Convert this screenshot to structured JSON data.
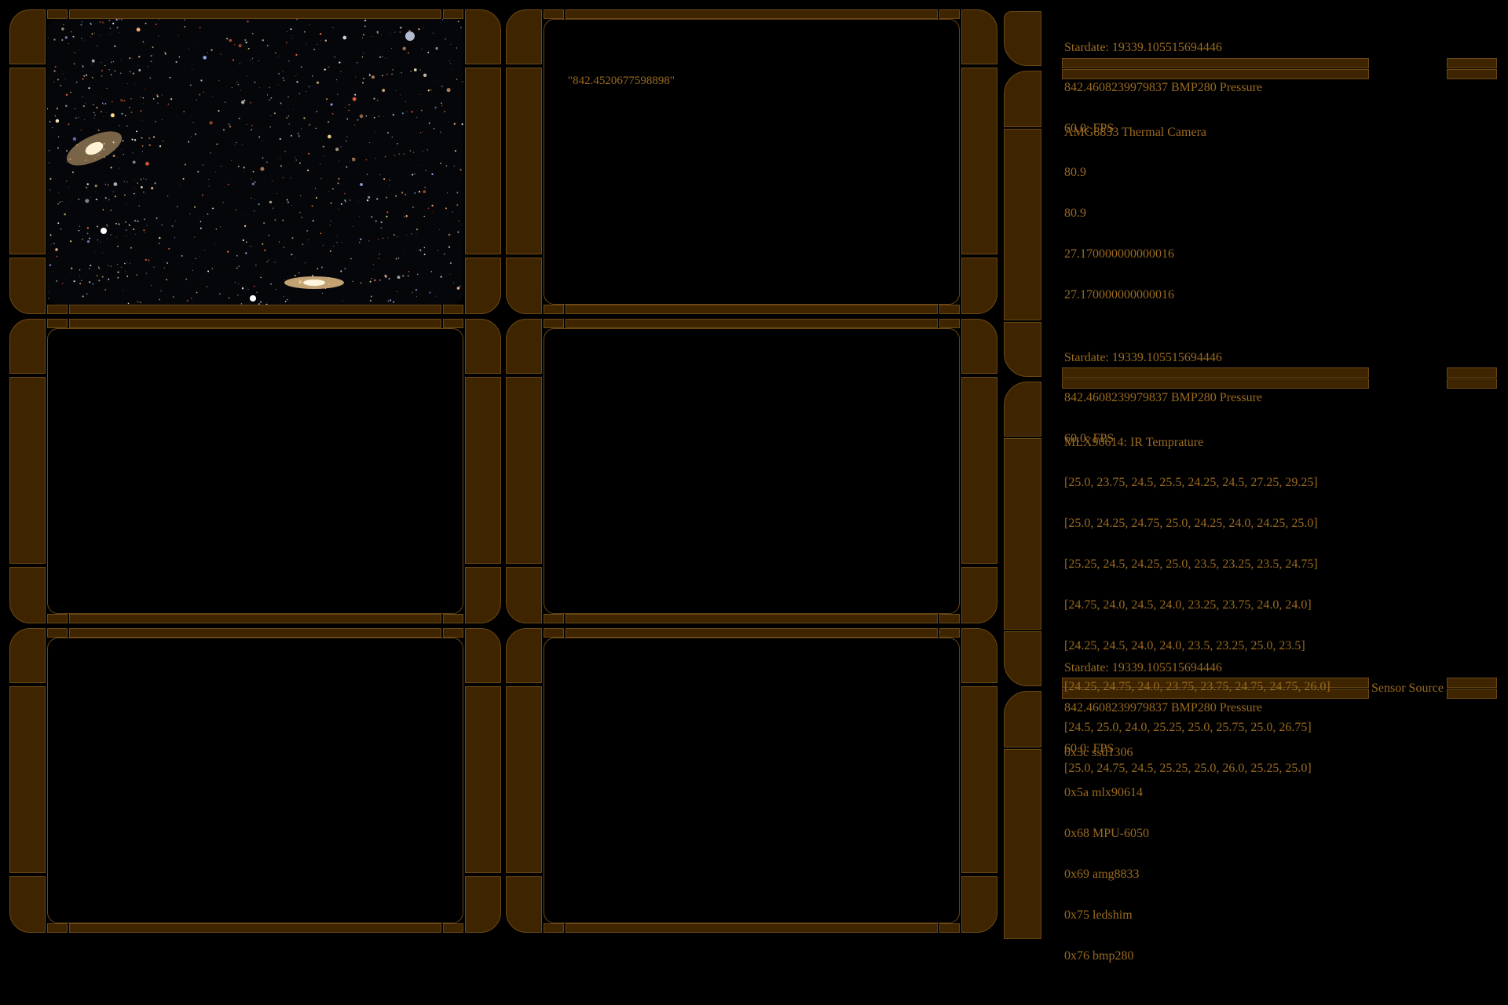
{
  "center_panel": {
    "readout": "\"842.4520677598898\""
  },
  "status_blocks": [
    {
      "stardate": "Stardate: 19339.105515694446",
      "pressure": "842.4608239979837 BMP280 Pressure",
      "fps": "60.0: FPS"
    },
    {
      "stardate": "Stardate: 19339.105515694446",
      "pressure": "842.4608239979837 BMP280 Pressure",
      "fps": "60.0: FPS"
    },
    {
      "stardate": "Stardate: 19339.105515694446",
      "pressure": "842.4608239979837 BMP280 Pressure",
      "fps": "60.0: FPS"
    }
  ],
  "thermal": {
    "title": "AMG8833 Thermal Camera",
    "values": [
      "80.9",
      "80.9",
      "27.170000000000016",
      "27.170000000000016"
    ]
  },
  "ir": {
    "title": "MLX90614: IR Temprature",
    "rows": [
      "[25.0, 23.75, 24.5, 25.5, 24.25, 24.5, 27.25, 29.25]",
      "[25.0, 24.25, 24.75, 25.0, 24.25, 24.0, 24.25, 25.0]",
      "[25.25, 24.5, 24.25, 25.0, 23.5, 23.25, 23.5, 24.75]",
      "[24.75, 24.0, 24.5, 24.0, 23.25, 23.75, 24.0, 24.0]",
      "[24.25, 24.5, 24.0, 24.0, 23.5, 23.25, 25.0, 23.5]",
      "[24.25, 24.75, 24.0, 23.75, 23.75, 24.75, 24.75, 26.0]",
      "[24.5, 25.0, 24.0, 25.25, 25.0, 25.75, 25.0, 26.75]",
      "[25.0, 24.75, 24.5, 25.25, 25.0, 26.0, 25.25, 25.0]"
    ]
  },
  "sensor_source": {
    "label": "Sensor Source",
    "devices": [
      "0x3c ssd1306",
      "0x5a mlx90614",
      "0x68 MPU-6050",
      "0x69 amg8833",
      "0x75 ledshim",
      "0x76 bmp280"
    ]
  },
  "colors": {
    "frame": "#3e2500",
    "frame_border": "#6b4815",
    "text": "#9a6a1e",
    "background": "#000000"
  }
}
